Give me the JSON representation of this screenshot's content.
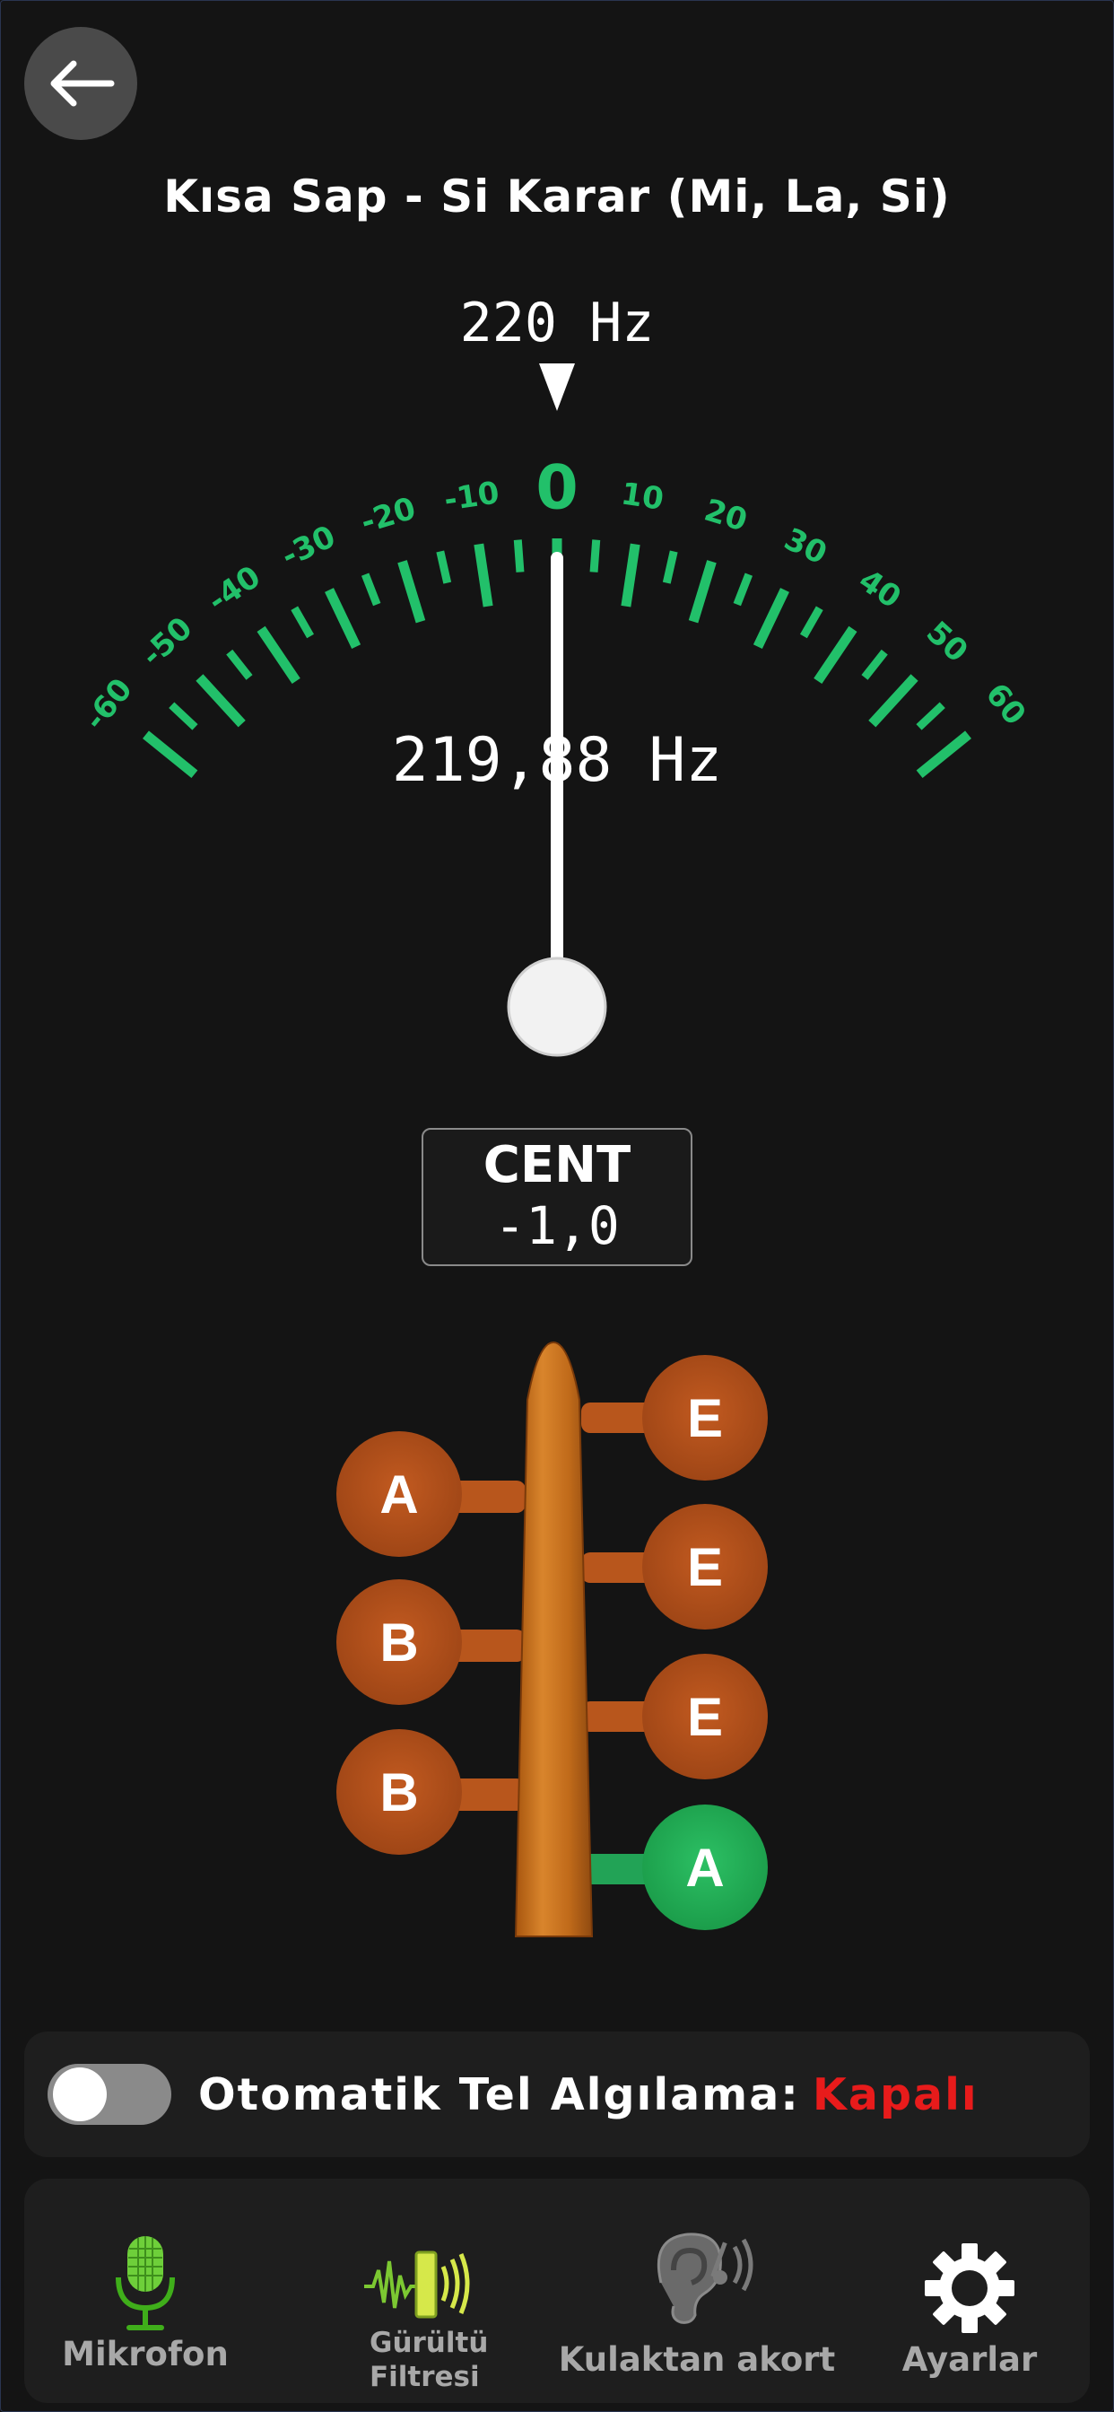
{
  "header": {
    "title": "Kısa Sap - Si Karar (Mi, La, Si)"
  },
  "tuner": {
    "target_freq": "220 Hz",
    "current_freq": "219,88 Hz",
    "cent_label": "CENT",
    "cent_value": "-1,0",
    "scale_labels": [
      "-60",
      "-50",
      "-40",
      "-30",
      "-20",
      "-10",
      "0",
      "10",
      "20",
      "30",
      "40",
      "50",
      "60"
    ]
  },
  "strings": {
    "left": [
      "A",
      "B",
      "B"
    ],
    "right": [
      "E",
      "E",
      "E",
      "A"
    ],
    "active": "right-4"
  },
  "auto_detect": {
    "label": "Otomatik Tel Algılama:",
    "state": "Kapalı",
    "enabled": false
  },
  "nav": {
    "items": [
      {
        "label": "Mikrofon",
        "icon": "microphone-icon"
      },
      {
        "label": "Gürültü Filtresi",
        "icon": "noise-filter-icon"
      },
      {
        "label": "Kulaktan akort",
        "icon": "ear-icon"
      },
      {
        "label": "Ayarlar",
        "icon": "gear-icon"
      }
    ]
  },
  "colors": {
    "accent": "#22c06a",
    "peg": "#b84f1a",
    "off": "#e81b1b",
    "panel": "#1e1e1e"
  }
}
